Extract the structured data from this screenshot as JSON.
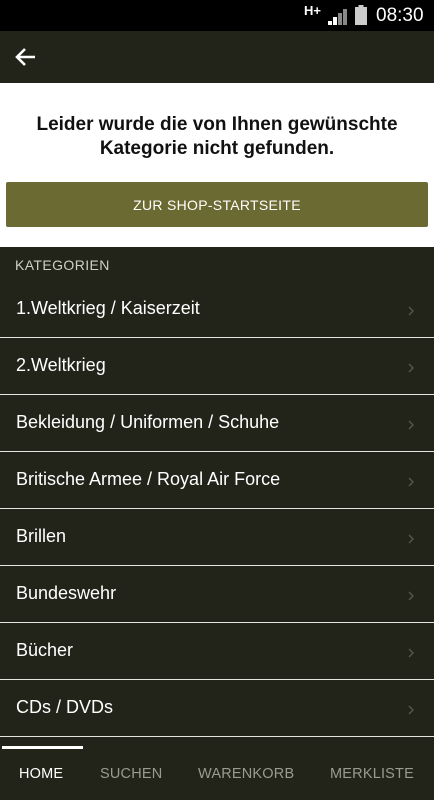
{
  "statusbar": {
    "network": "H+",
    "time": "08:30"
  },
  "notice": {
    "message": "Leider wurde die von Ihnen gewünschte Kategorie nicht gefunden.",
    "button_label": "ZUR SHOP-STARTSEITE"
  },
  "categories": {
    "header": "KATEGORIEN",
    "items": [
      {
        "label": "1.Weltkrieg / Kaiserzeit"
      },
      {
        "label": "2.Weltkrieg"
      },
      {
        "label": "Bekleidung / Uniformen / Schuhe"
      },
      {
        "label": "Britische Armee / Royal Air Force"
      },
      {
        "label": "Brillen"
      },
      {
        "label": "Bundeswehr"
      },
      {
        "label": "Bücher"
      },
      {
        "label": "CDs / DVDs"
      }
    ]
  },
  "bottom_nav": {
    "tabs": [
      {
        "label": "HOME",
        "active": true
      },
      {
        "label": "SUCHEN"
      },
      {
        "label": "WARENKORB"
      },
      {
        "label": "MERKLISTE"
      }
    ]
  },
  "colors": {
    "background": "#22241a",
    "accent_button": "#6b6a32",
    "text_primary": "#ffffff",
    "text_inactive": "#9a9b8f"
  }
}
